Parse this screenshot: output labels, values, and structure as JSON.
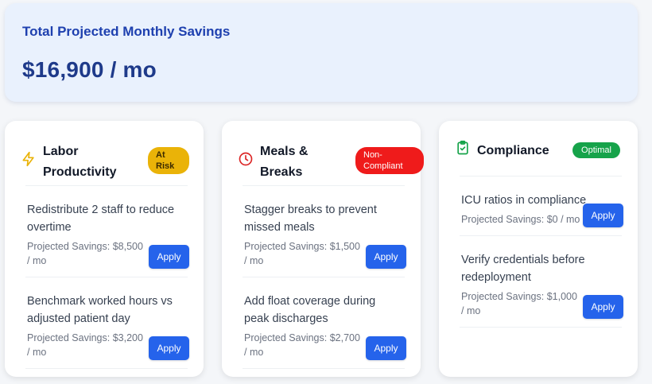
{
  "summary": {
    "title": "Total Projected Monthly Savings",
    "value": "$16,900 / mo"
  },
  "cards": [
    {
      "title": "Labor Productivity",
      "icon": "lightning-icon",
      "badge": "At Risk",
      "badge_color": "#eab308",
      "items": [
        {
          "text": "Redistribute 2 staff to reduce overtime",
          "savings": "Projected Savings: $8,500 / mo",
          "button": "Apply"
        },
        {
          "text": "Benchmark worked hours vs adjusted patient day",
          "savings": "Projected Savings: $3,200 / mo",
          "button": "Apply"
        }
      ]
    },
    {
      "title": "Meals & Breaks",
      "icon": "clock-icon",
      "badge": "Non-Compliant",
      "badge_color": "#ef1b1b",
      "items": [
        {
          "text": "Stagger breaks to prevent missed meals",
          "savings": "Projected Savings: $1,500 / mo",
          "button": "Apply"
        },
        {
          "text": "Add float coverage during peak discharges",
          "savings": "Projected Savings: $2,700 / mo",
          "button": "Apply"
        }
      ]
    },
    {
      "title": "Compliance",
      "icon": "clipboard-check-icon",
      "badge": "Optimal",
      "badge_color": "#16a34a",
      "items": [
        {
          "text": "ICU ratios in compliance",
          "savings": "Projected Savings: $0 / mo",
          "button": "Apply"
        },
        {
          "text": "Verify credentials before redeployment",
          "savings": "Projected Savings: $1,000 / mo",
          "button": "Apply"
        }
      ]
    }
  ],
  "colors": {
    "accent": "#2563eb",
    "summary_bg": "#e9f1fd",
    "summary_text": "#1e40af"
  }
}
